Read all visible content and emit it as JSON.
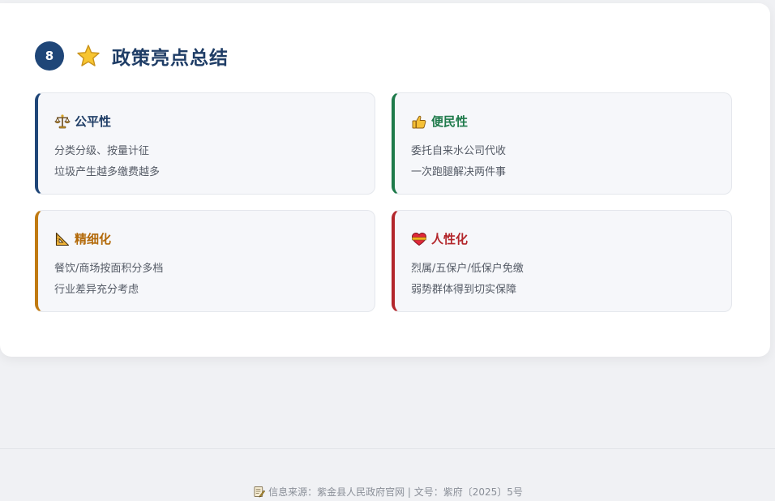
{
  "section": {
    "number": "8",
    "icon": "star-icon",
    "title": "政策亮点总结"
  },
  "features": [
    {
      "title": "公平性",
      "icon": "balance-scale-icon",
      "color": "#1f4678",
      "lines": [
        "分类分级、按量计征",
        "垃圾产生越多缴费越多"
      ]
    },
    {
      "title": "便民性",
      "icon": "thumbs-up-icon",
      "color": "#1e7a4a",
      "lines": [
        "委托自来水公司代收",
        "一次跑腿解决两件事"
      ]
    },
    {
      "title": "精细化",
      "icon": "triangle-ruler-icon",
      "color": "#c07a12",
      "lines": [
        "餐饮/商场按面积分多档",
        "行业差异充分考虑"
      ]
    },
    {
      "title": "人性化",
      "icon": "heart-ribbon-icon",
      "color": "#b3262b",
      "lines": [
        "烈属/五保户/低保户免缴",
        "弱势群体得到切实保障"
      ]
    }
  ],
  "footer": {
    "icon": "memo-icon",
    "text": "信息来源：紫金县人民政府官网 | 文号：紫府〔2025〕5号"
  }
}
